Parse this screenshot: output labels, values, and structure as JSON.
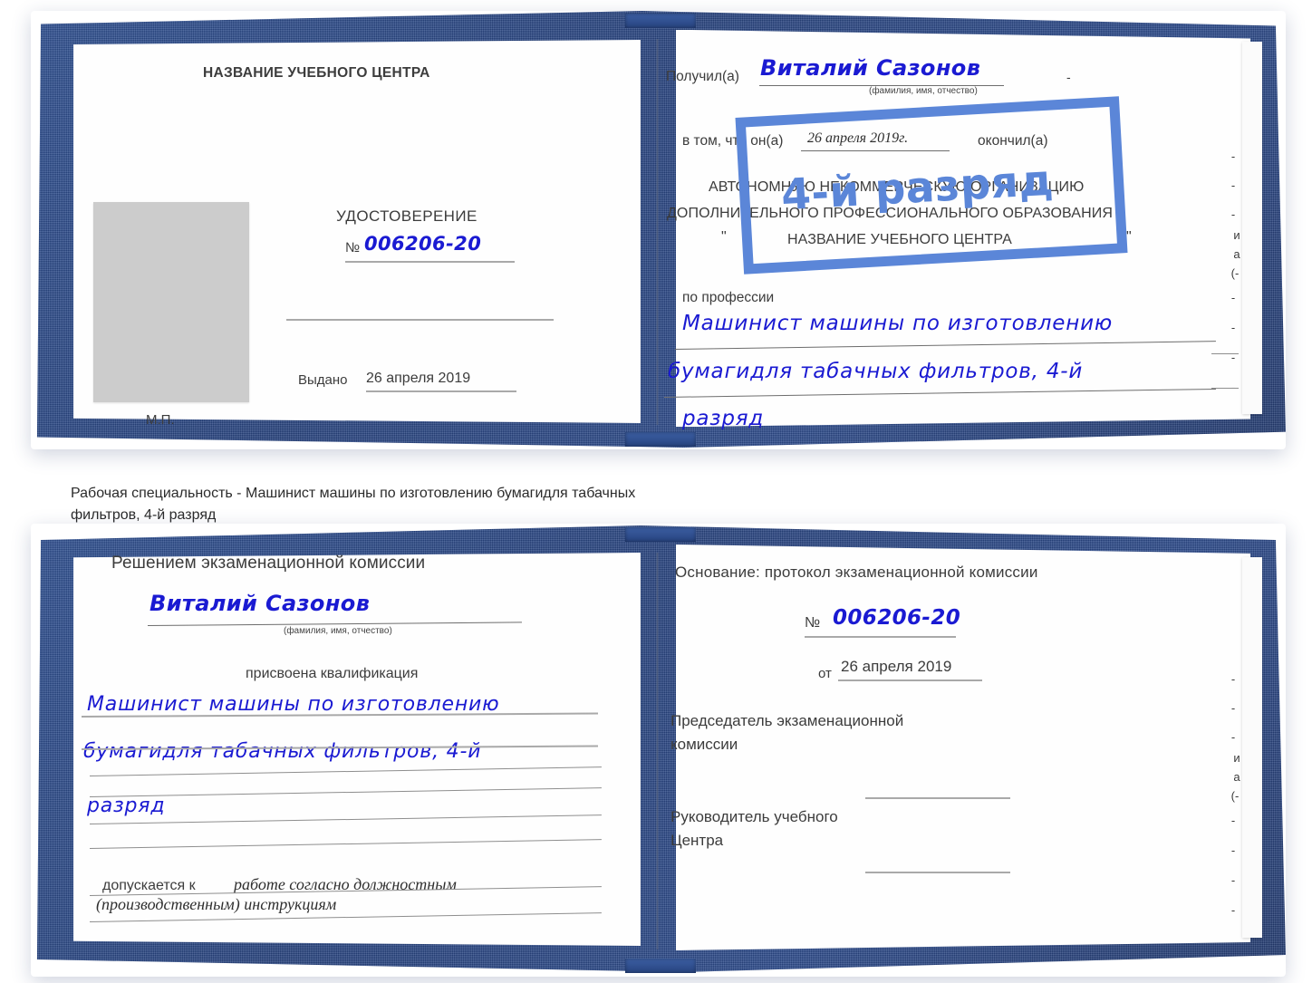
{
  "document": {
    "kind": "certificate-scan",
    "ink_color": "#1a1ad2",
    "cover_color": "#2c4a8b",
    "stamp_color": "#5b86d8",
    "photo_placeholder_color": "#cccccc"
  },
  "caption": {
    "line1": "Рабочая специальность - Машинист машины по изготовлению бумагидля табачных",
    "line2": "фильтров, 4-й разряд"
  },
  "top_spread": {
    "left_page": {
      "center_name": "НАЗВАНИЕ УЧЕБНОГО ЦЕНТРА",
      "title": "УДОСТОВЕРЕНИЕ",
      "number_label": "№",
      "number_value": "006206-20",
      "issued_label": "Выдано",
      "issued_value": "26 апреля 2019",
      "seal_label": "М.П."
    },
    "right_page": {
      "received_label": "Получил(а)",
      "received_value": "Виталий Сазонов",
      "name_hint": "(фамилия, имя, отчество)",
      "that_he_label": "в том, что он(а)",
      "date_value": "26 апреля 2019г.",
      "finished_label": "окончил(а)",
      "org_line1": "АВТОНОМНУЮ НЕКОММЕРЧЕСКУЮ ОРГАНИЗАЦИЮ",
      "org_line2": "ДОПОЛНИТЕЛЬНОГО ПРОФЕССИОНАЛЬНОГО ОБРАЗОВАНИЯ",
      "org_quote_open": "\"",
      "org_line3": "НАЗВАНИЕ УЧЕБНОГО ЦЕНТРА",
      "org_quote_close": "\"",
      "profession_label": "по профессии",
      "profession_line1": "Машинист машины по изготовлению",
      "profession_line2": "бумагидля табачных фильтров, 4-й",
      "profession_line3": "разряд",
      "stamp_text": "4-й разряд"
    },
    "edge_fragments": [
      "-",
      "-",
      "-",
      "и",
      "а",
      "(-",
      "-",
      "-",
      "-",
      "-"
    ]
  },
  "bottom_spread": {
    "left_page": {
      "heading": "Решением экзаменационной комиссии",
      "name_value": "Виталий Сазонов",
      "name_hint": "(фамилия, имя, отчество)",
      "qualification_label": "присвоена квалификация",
      "qualification_line1": "Машинист машины по изготовлению",
      "qualification_line2": "бумагидля табачных фильтров, 4-й",
      "qualification_line3": "разряд",
      "admitted_label": "допускается к",
      "admitted_value_line1": "работе согласно должностным",
      "admitted_value_line2": "(производственным) инструкциям"
    },
    "right_page": {
      "basis_label": "Основание: протокол экзаменационной комиссии",
      "number_label": "№",
      "number_value": "006206-20",
      "date_label": "от",
      "date_value": "26 апреля 2019",
      "chairman_line1": "Председатель экзаменационной",
      "chairman_line2": "комиссии",
      "head_line1": "Руководитель учебного",
      "head_line2": "Центра"
    },
    "edge_fragments": [
      "-",
      "-",
      "-",
      "и",
      "а",
      "(-",
      "-",
      "-",
      "-",
      "-"
    ]
  }
}
